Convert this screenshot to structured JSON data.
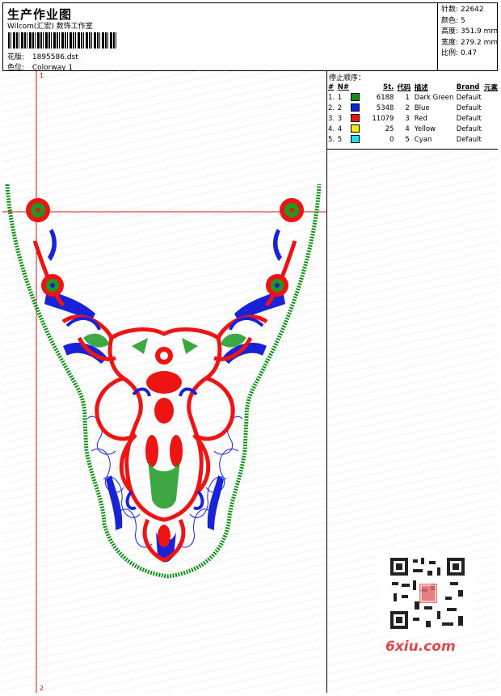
{
  "header": {
    "title": "生产作业图",
    "studio": "Wilcom(汇宏) 数饰工作室",
    "design_label": "花版:",
    "design_file": "1895586.dst",
    "colorway_label": "色位:",
    "colorway": "Colorway 1"
  },
  "stats": {
    "stitches_label": "针数:",
    "stitches": "22642",
    "colors_label": "颜色:",
    "colors": "5",
    "height_label": "高度:",
    "height": "351.9 mm",
    "width_label": "宽度:",
    "width": "279.2 mm",
    "ratio_label": "比例:",
    "ratio": "0.47"
  },
  "sequence": {
    "title": "停止顺序：",
    "headers": [
      "#",
      "N#",
      "St.",
      "代码",
      "描述",
      "Brand",
      "元素"
    ],
    "rows": [
      {
        "idx": "1.",
        "n": "1",
        "color": "#109010",
        "st": "6188",
        "code": "1",
        "desc": "Dark Green",
        "brand": "Default"
      },
      {
        "idx": "2.",
        "n": "2",
        "color": "#1020e0",
        "st": "5348",
        "code": "2",
        "desc": "Blue",
        "brand": "Default"
      },
      {
        "idx": "3.",
        "n": "3",
        "color": "#f01010",
        "st": "11079",
        "code": "3",
        "desc": "Red",
        "brand": "Default"
      },
      {
        "idx": "4.",
        "n": "4",
        "color": "#f0f000",
        "st": "25",
        "code": "4",
        "desc": "Yellow",
        "brand": "Default"
      },
      {
        "idx": "5.",
        "n": "5",
        "color": "#20e0e0",
        "st": "0",
        "code": "5",
        "desc": "Cyan",
        "brand": "Default"
      }
    ]
  },
  "markers": {
    "start": "1",
    "end": "2"
  },
  "watermark": {
    "site": "6xiu.com"
  }
}
